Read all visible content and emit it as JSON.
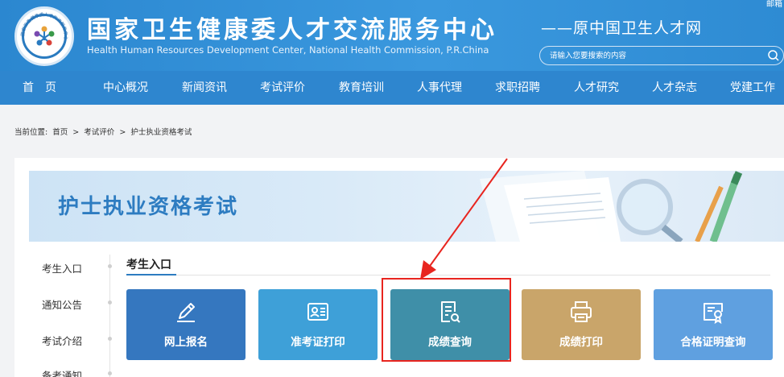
{
  "header": {
    "site_title": "国家卫生健康委人才交流服务中心",
    "site_subtitle": "Health Human Resources Development Center, National Health Commission, P.R.China",
    "slogan": "——原中国卫生人才网",
    "top_right_link": "邮箱",
    "logo_ring_text": "国家卫生健康委人才交流服务中心",
    "search": {
      "placeholder": "请输入您要搜索的内容",
      "value": ""
    }
  },
  "nav": {
    "items": [
      {
        "label": "首　页"
      },
      {
        "label": "中心概况"
      },
      {
        "label": "新闻资讯"
      },
      {
        "label": "考试评价"
      },
      {
        "label": "教育培训"
      },
      {
        "label": "人事代理"
      },
      {
        "label": "求职招聘"
      },
      {
        "label": "人才研究"
      },
      {
        "label": "人才杂志"
      },
      {
        "label": "党建工作"
      }
    ]
  },
  "breadcrumb": {
    "prefix": "当前位置:",
    "items": [
      "首页",
      ">",
      "考试评价",
      ">",
      "护士执业资格考试"
    ]
  },
  "banner": {
    "title": "护士执业资格考试"
  },
  "sidebar": {
    "items": [
      {
        "label": "考生入口"
      },
      {
        "label": "通知公告"
      },
      {
        "label": "考试介绍"
      },
      {
        "label": "备考通知"
      }
    ]
  },
  "main": {
    "section_title": "考生入口",
    "tiles": [
      {
        "label": "网上报名",
        "icon": "pencil-icon",
        "color": "#3577bf"
      },
      {
        "label": "准考证打印",
        "icon": "id-card-icon",
        "color": "#3ea0d8"
      },
      {
        "label": "成绩查询",
        "icon": "document-search-icon",
        "color": "#3f8fa8"
      },
      {
        "label": "成绩打印",
        "icon": "printer-icon",
        "color": "#c9a56a"
      },
      {
        "label": "合格证明查询",
        "icon": "certificate-search-icon",
        "color": "#5fa0e0"
      }
    ]
  },
  "colors": {
    "header_blue": "#2e86cf",
    "accent": "#2d7cc1",
    "highlight": "#e8251f"
  }
}
